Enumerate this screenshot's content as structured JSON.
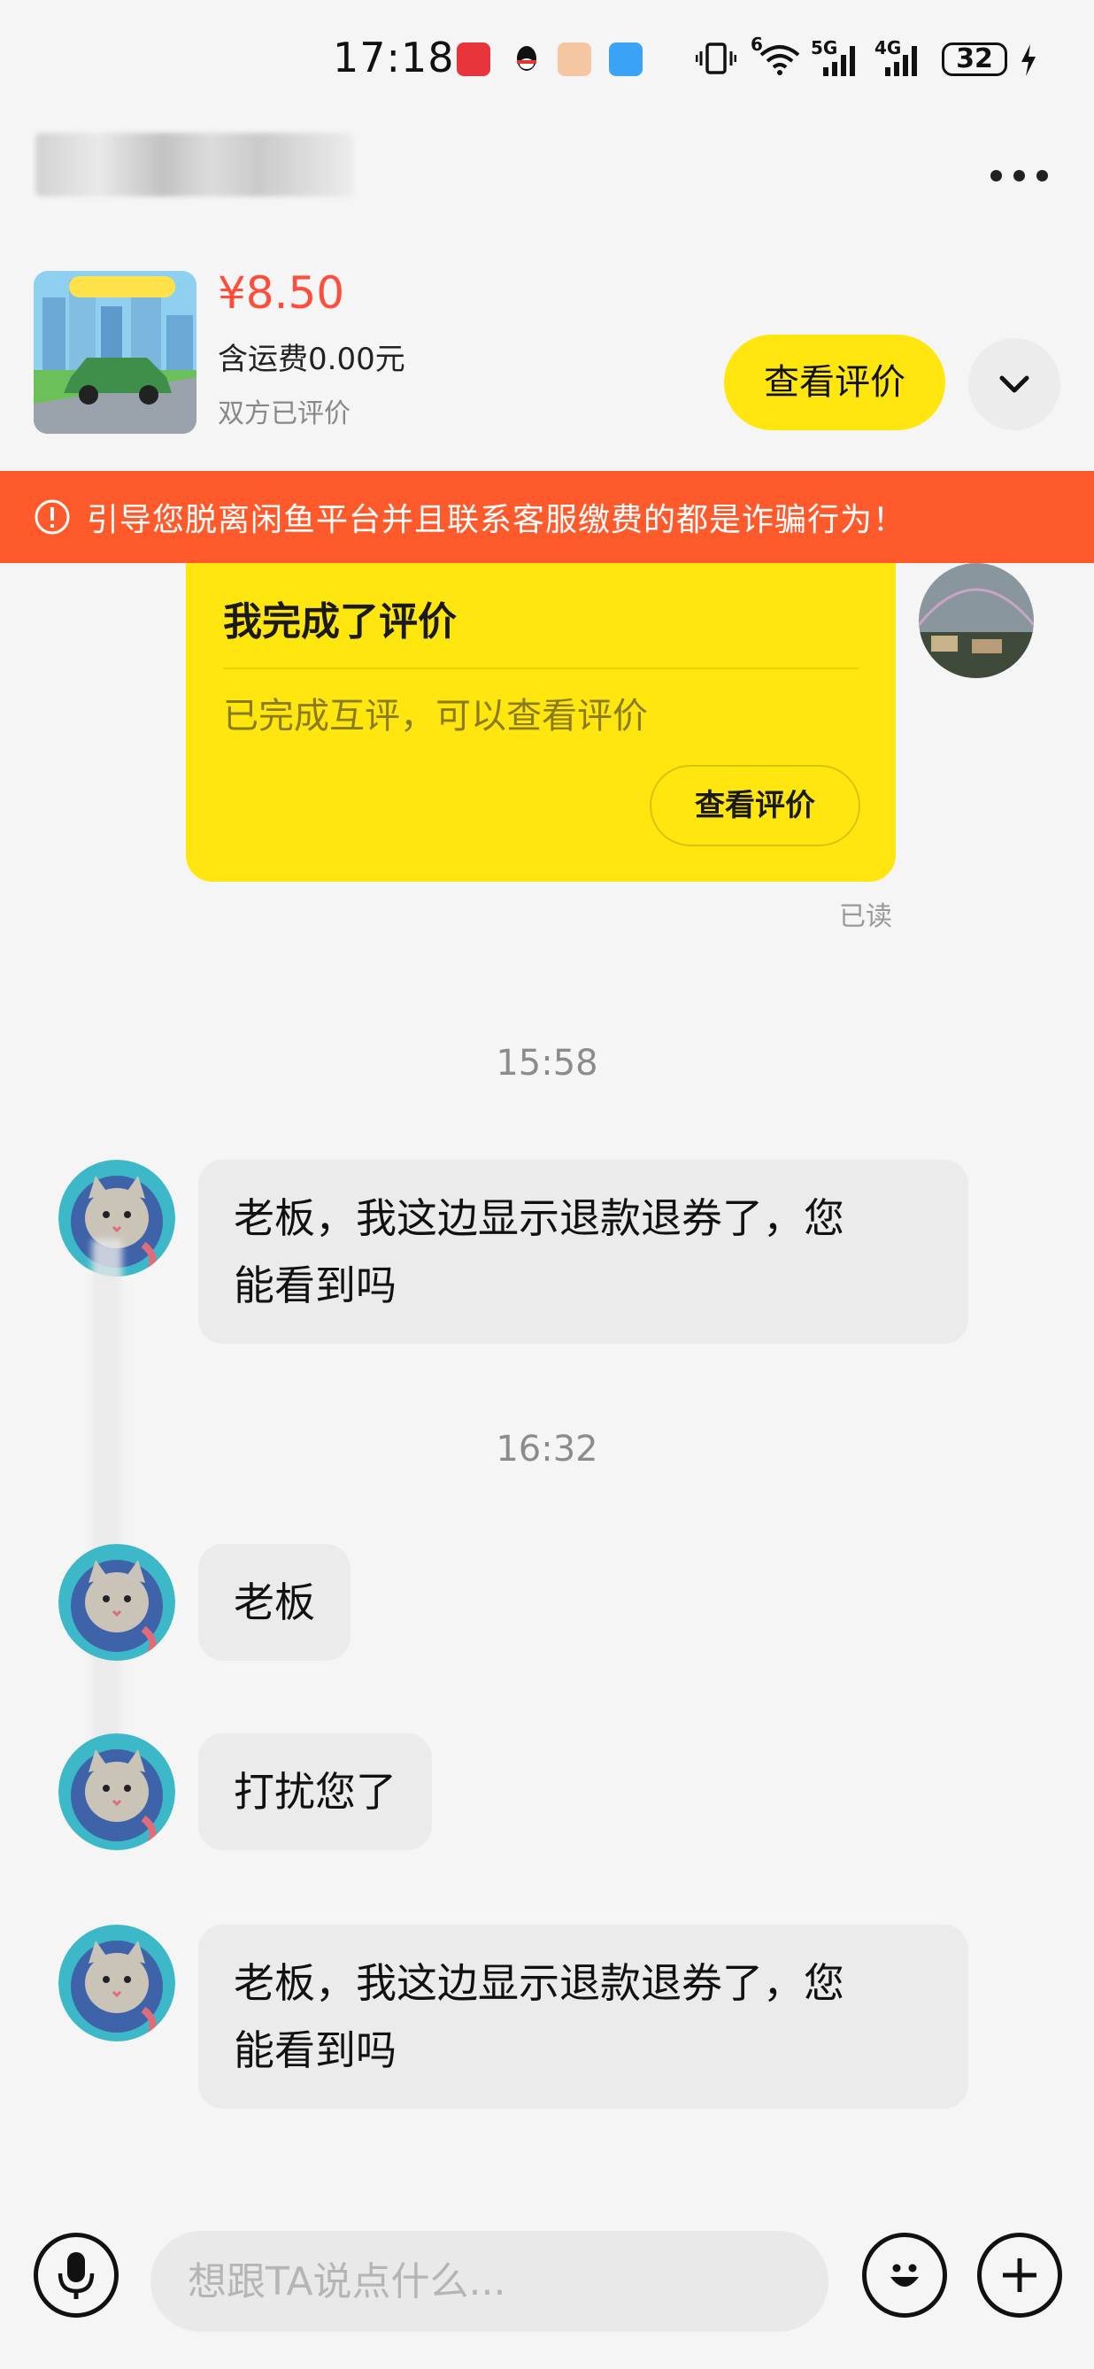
{
  "status_bar": {
    "time": "17:18",
    "battery": "32",
    "network_a": "5G",
    "network_b": "4G",
    "wifi_gen": "6",
    "app_icons": [
      "huawei-store-icon",
      "qq-icon",
      "app-icon",
      "weather-icon"
    ]
  },
  "header": {
    "more_icon": "more-dots-icon"
  },
  "product": {
    "price": "¥8.50",
    "shipping": "含运费0.00元",
    "status": "双方已评价",
    "view_review_label": "查看评价"
  },
  "warning": {
    "text": "引导您脱离闲鱼平台并且联系客服缴费的都是诈骗行为！"
  },
  "messages": {
    "review_card": {
      "title": "我完成了评价",
      "desc": "已完成互评，可以查看评价",
      "button": "查看评价"
    },
    "read_receipt": "已读",
    "timestamp_1": "15:58",
    "msg_1_line1": "老板，我这边显示退款退券了，您",
    "msg_1_line2": "能看到吗",
    "timestamp_2": "16:32",
    "msg_2": "老板",
    "msg_3": "打扰您了",
    "msg_4_line1": "老板，我这边显示退款退券了，您",
    "msg_4_line2": "能看到吗"
  },
  "input": {
    "placeholder": "想跟TA说点什么..."
  },
  "colors": {
    "accent_yellow": "#ffe60f",
    "warning_red": "#ff5a2c",
    "price_red": "#ff4c3b"
  }
}
